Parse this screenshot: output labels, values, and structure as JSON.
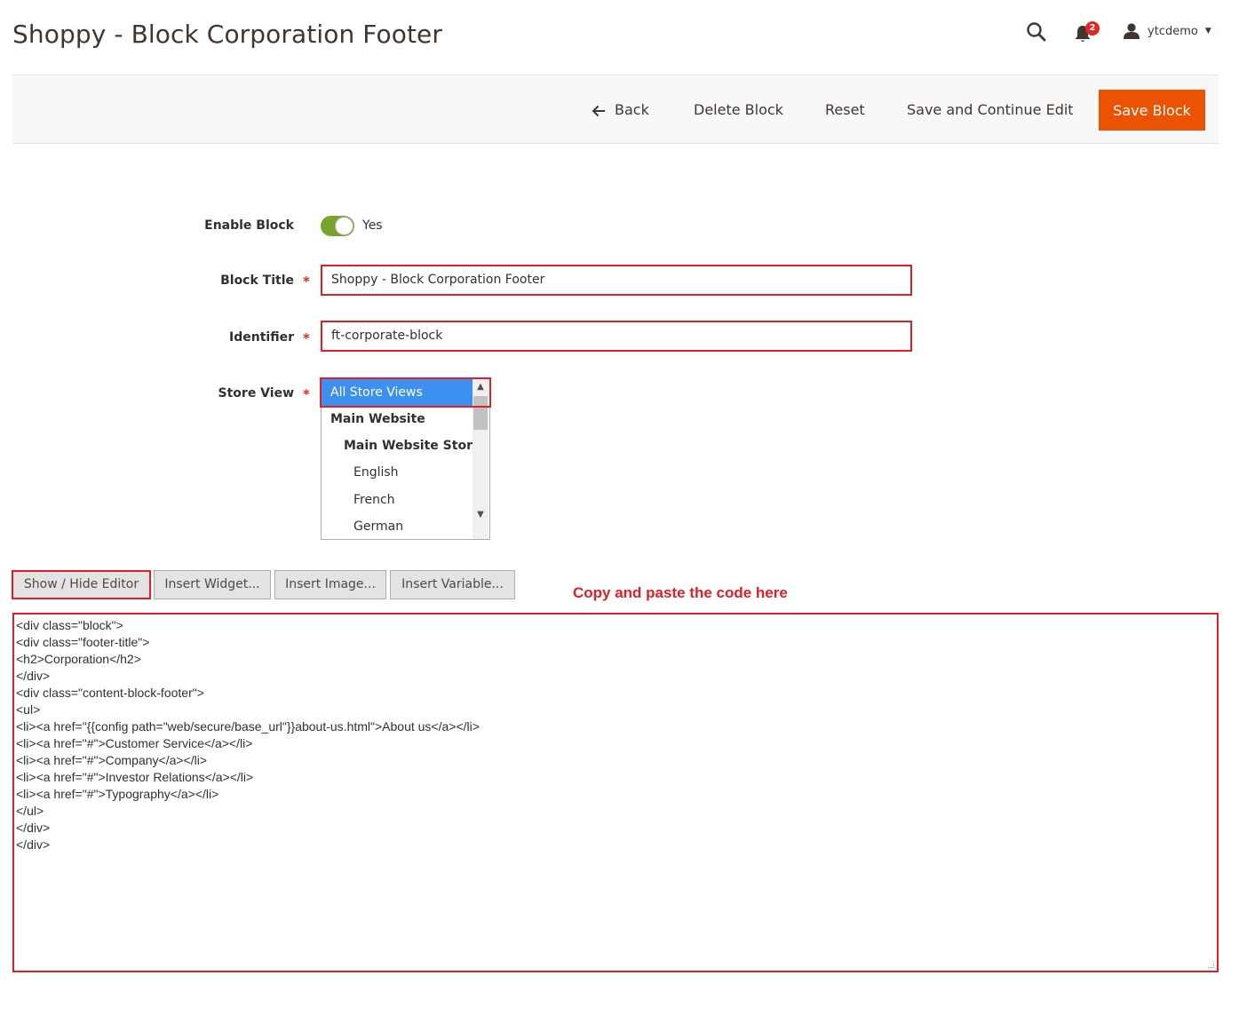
{
  "page": {
    "title": "Shoppy - Block Corporation Footer"
  },
  "header": {
    "notification_count": "2",
    "user_name": "ytcdemo"
  },
  "toolbar": {
    "back_label": "Back",
    "delete_label": "Delete Block",
    "reset_label": "Reset",
    "save_continue_label": "Save and Continue Edit",
    "save_label": "Save Block"
  },
  "form": {
    "enable": {
      "label": "Enable Block",
      "value": "Yes",
      "checked": true
    },
    "title": {
      "label": "Block Title",
      "value": "Shoppy - Block Corporation Footer"
    },
    "identifier": {
      "label": "Identifier",
      "value": "ft-corporate-block"
    },
    "store_view": {
      "label": "Store View",
      "options": [
        {
          "label": "All Store Views",
          "selected": true,
          "level": 0,
          "bold": false
        },
        {
          "label": "Main Website",
          "selected": false,
          "level": 0,
          "bold": true
        },
        {
          "label": "Main Website Store",
          "selected": false,
          "level": 1,
          "bold": true
        },
        {
          "label": "English",
          "selected": false,
          "level": 2,
          "bold": false
        },
        {
          "label": "French",
          "selected": false,
          "level": 2,
          "bold": false
        },
        {
          "label": "German",
          "selected": false,
          "level": 2,
          "bold": false
        }
      ]
    },
    "required_mark": "*"
  },
  "editor": {
    "buttons": {
      "show_hide": "Show / Hide Editor",
      "insert_widget": "Insert Widget...",
      "insert_image": "Insert Image...",
      "insert_variable": "Insert Variable..."
    },
    "hint": "Copy and paste the code here",
    "content_lines": [
      "<div class=\"block\">",
      "<div class=\"footer-title\">",
      "<h2>Corporation</h2>",
      "</div>",
      "<div class=\"content-block-footer\">",
      "<ul>",
      "<li><a href=\"{{config path=\"web/secure/base_url\"}}about-us.html\">About us</a></li>",
      "<li><a href=\"#\">Customer Service</a></li>",
      "<li><a href=\"#\">Company</a></li>",
      "<li><a href=\"#\">Investor Relations</a></li>",
      "<li><a href=\"#\">Typography</a></li>",
      "</ul>",
      "</div>",
      "</div>"
    ]
  },
  "colors": {
    "accent": "#eb5202",
    "highlight": "#e31e24",
    "toggle_on": "#79a22e",
    "selected_option": "#3d8ff0"
  }
}
